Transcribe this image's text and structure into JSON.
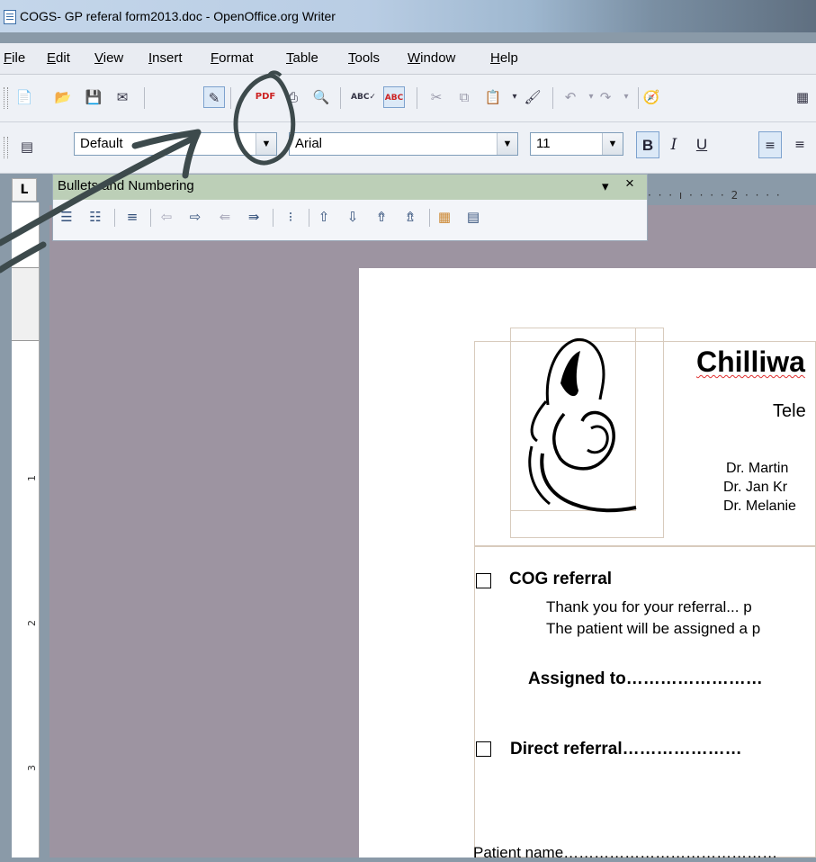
{
  "window": {
    "title": "COGS- GP referal form2013.doc - OpenOffice.org Writer"
  },
  "menu": [
    "File",
    "Edit",
    "View",
    "Insert",
    "Format",
    "Table",
    "Tools",
    "Window",
    "Help"
  ],
  "format_toolbar": {
    "paragraph_style": "Default",
    "font_name": "Arial",
    "font_size": "11",
    "bold": "B",
    "italic": "I",
    "underline": "U"
  },
  "bullets_panel": {
    "title": "Bullets and Numbering",
    "close": "×",
    "menu": "▾"
  },
  "ruler": {
    "h_label": "2",
    "v_marks": [
      "1",
      "2",
      "3"
    ]
  },
  "document": {
    "clinic_name_partial": "Chilliwa",
    "phone_partial": "Tele",
    "doctors": [
      "Dr. Martin",
      "Dr. Jan Kr",
      "Dr. Melanie"
    ],
    "cog_heading": "COG referral",
    "cog_line1": "Thank you for your referral... p",
    "cog_line2": "The patient will be assigned a p",
    "assigned_to": "Assigned to……………………",
    "direct_referral": "Direct referral…………………",
    "patient_name": "Patient name……………………………………"
  },
  "colors": {
    "annotation_ink": "#3d4a4c",
    "panel_bar": "#bccfb7",
    "workspace": "#9d94a1"
  },
  "icons": [
    "new-icon",
    "open-icon",
    "save-icon",
    "email-icon",
    "edit-icon",
    "pdf-icon",
    "print-icon",
    "preview-icon",
    "spellcheck-icon",
    "autospell-icon",
    "cut-icon",
    "copy-icon",
    "paste-icon",
    "clone-icon",
    "undo-icon",
    "redo-icon",
    "navigator-icon",
    "table-icon"
  ]
}
